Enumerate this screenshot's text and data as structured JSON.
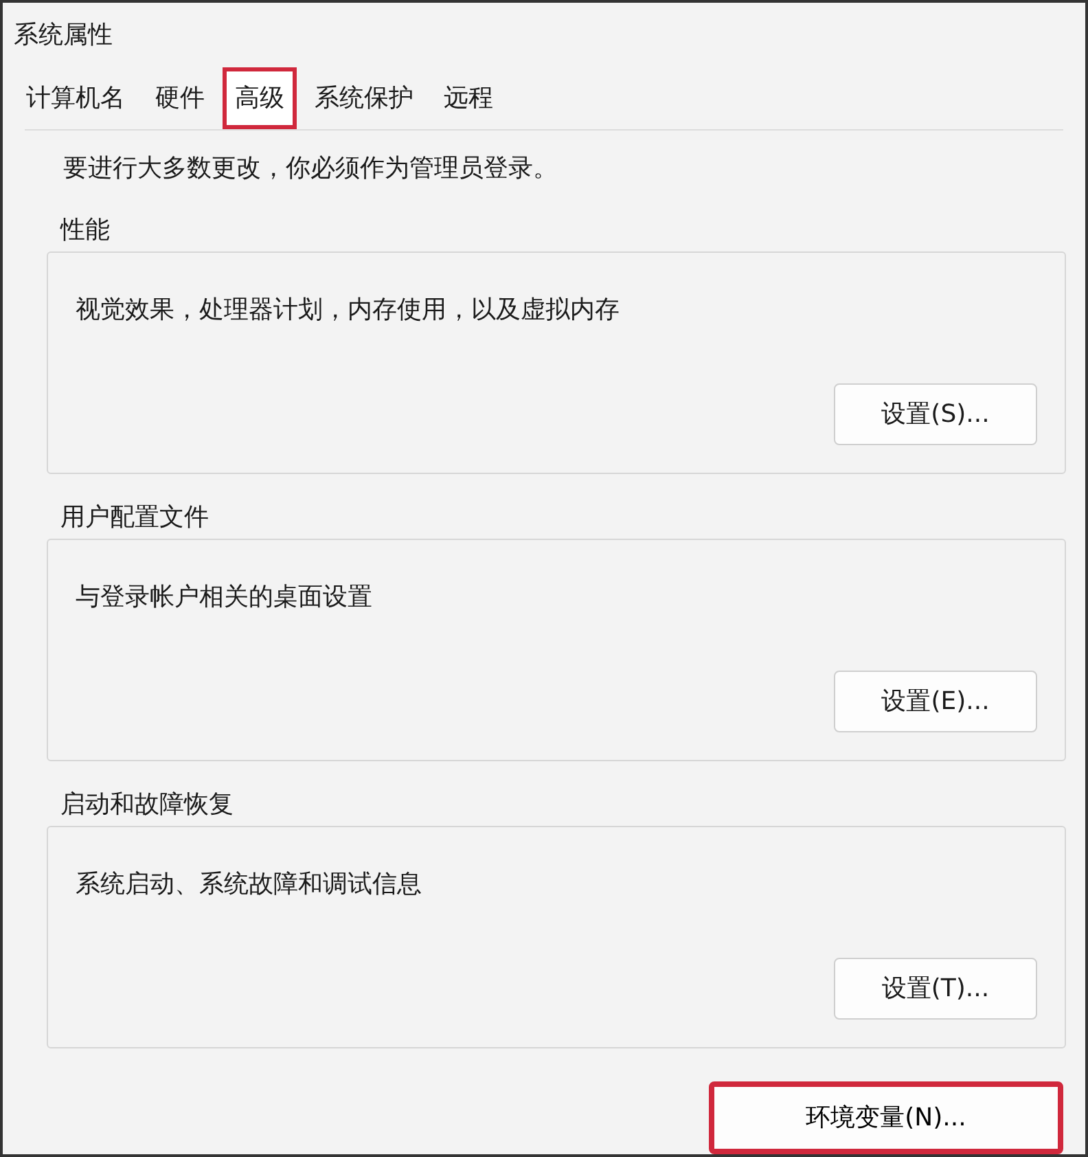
{
  "window": {
    "title": "系统属性"
  },
  "tabs": [
    {
      "label": "计算机名",
      "selected": false,
      "highlighted": false
    },
    {
      "label": "硬件",
      "selected": false,
      "highlighted": false
    },
    {
      "label": "高级",
      "selected": true,
      "highlighted": true
    },
    {
      "label": "系统保护",
      "selected": false,
      "highlighted": false
    },
    {
      "label": "远程",
      "selected": false,
      "highlighted": false
    }
  ],
  "notice": "要进行大多数更改，你必须作为管理员登录。",
  "groups": [
    {
      "title": "性能",
      "description": "视觉效果，处理器计划，内存使用，以及虚拟内存",
      "button": "设置(S)..."
    },
    {
      "title": "用户配置文件",
      "description": "与登录帐户相关的桌面设置",
      "button": "设置(E)..."
    },
    {
      "title": "启动和故障恢复",
      "description": "系统启动、系统故障和调试信息",
      "button": "设置(T)..."
    }
  ],
  "env_button": {
    "label": "环境变量(N)...",
    "highlighted": true
  }
}
